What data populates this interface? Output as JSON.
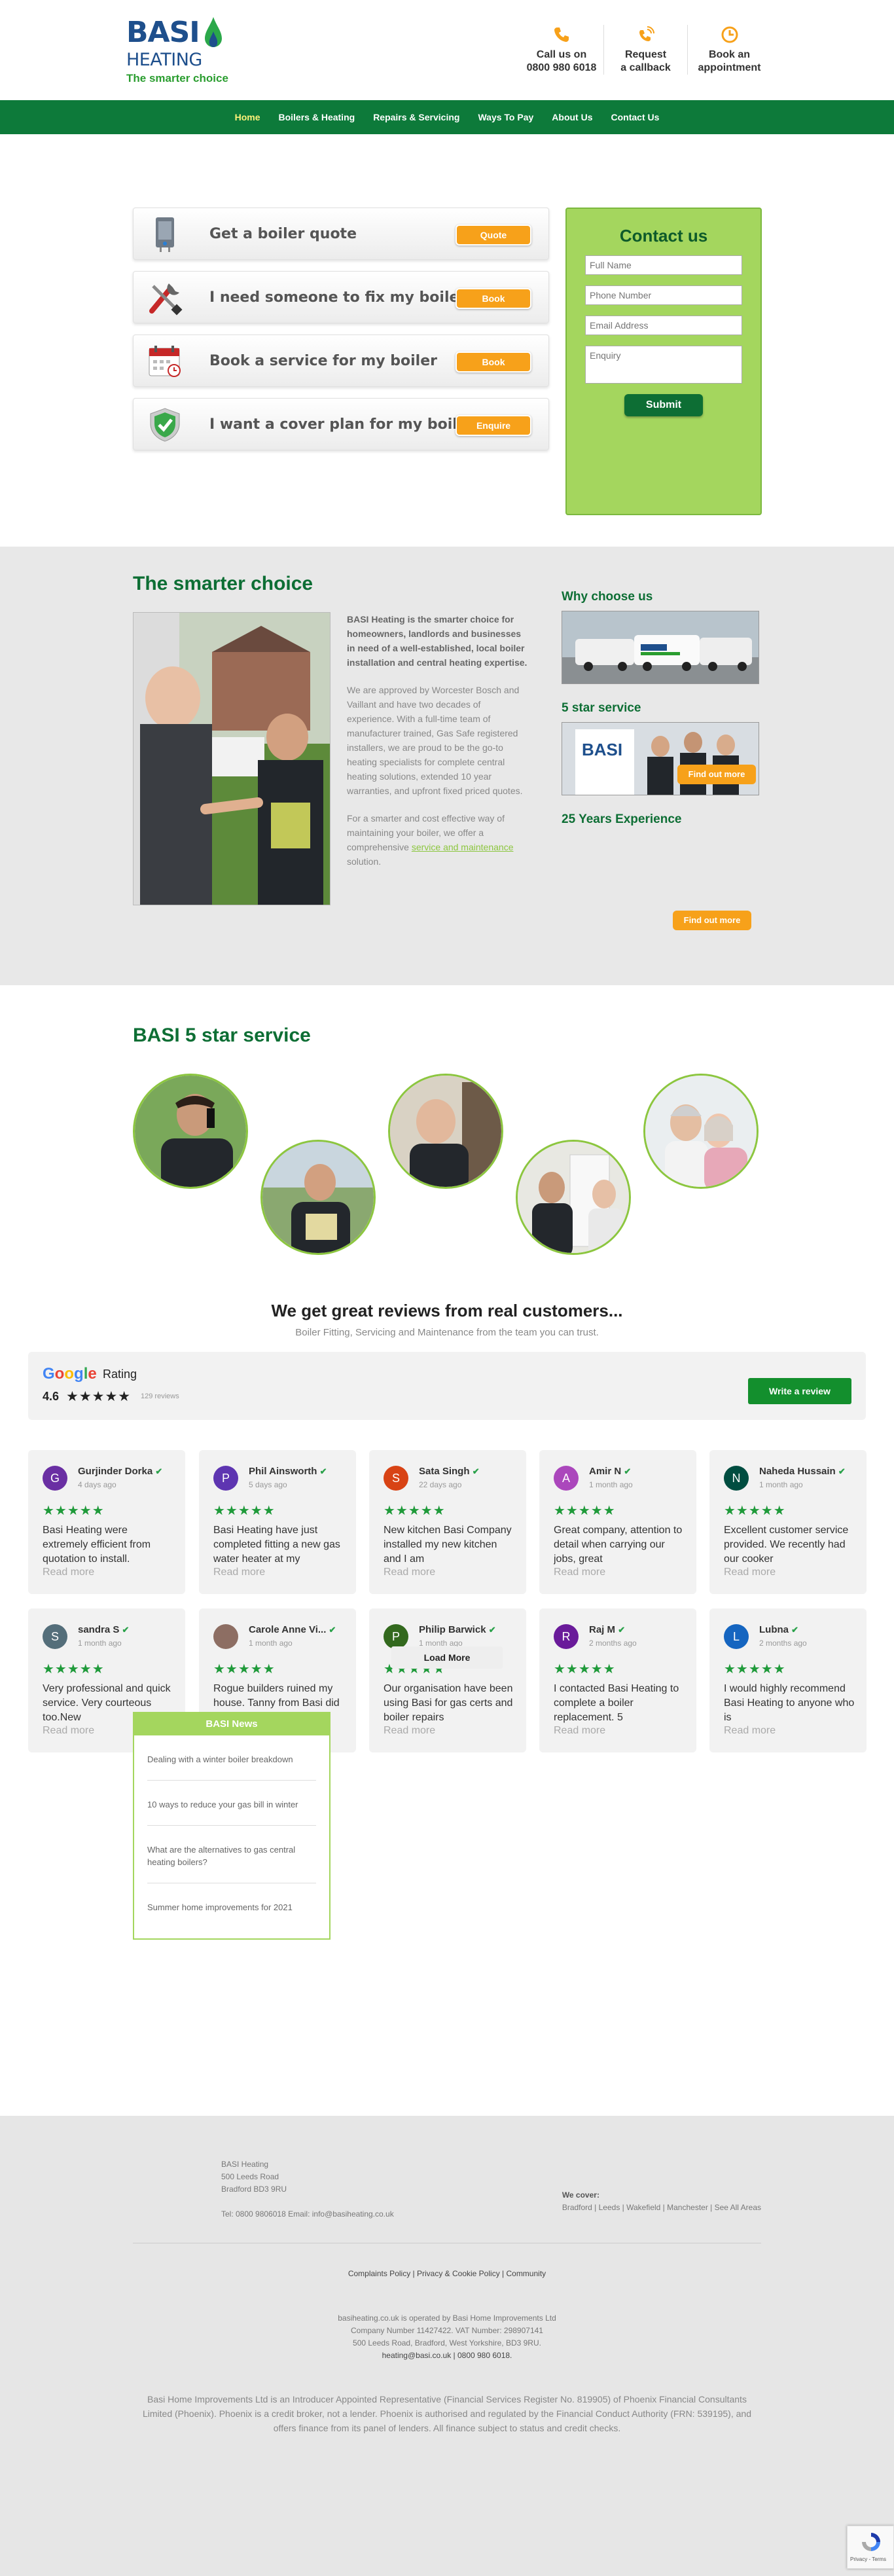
{
  "brand": {
    "name_top": "BASI",
    "name_bottom": "HEATING",
    "tagline": "The smarter choice",
    "green": "#0d7a3a",
    "orange": "#f7a11a",
    "lightgreen": "#a4d65e"
  },
  "header_contacts": [
    {
      "icon": "phone-icon",
      "line1": "Call us on",
      "line2": "0800 980 6018"
    },
    {
      "icon": "callback-icon",
      "line1": "Request",
      "line2": "a callback"
    },
    {
      "icon": "clock-icon",
      "line1": "Book an",
      "line2": "appointment"
    }
  ],
  "nav": [
    "Home",
    "Boilers & Heating",
    "Repairs & Servicing",
    "Ways To Pay",
    "About Us",
    "Contact Us"
  ],
  "cards": [
    {
      "icon": "boiler-icon",
      "text": "Get a boiler quote",
      "button": "Quote"
    },
    {
      "icon": "tools-icon",
      "text": "I need someone to fix my boiler",
      "button": "Book"
    },
    {
      "icon": "calendar-icon",
      "text": "Book a service for my boiler",
      "button": "Book"
    },
    {
      "icon": "shield-check-icon",
      "text": "I want a cover plan for my boiler",
      "button": "Enquire"
    }
  ],
  "contact_form": {
    "title": "Contact us",
    "name_placeholder": "Full Name",
    "phone_placeholder": "Phone Number",
    "email_placeholder": "Email Address",
    "enquiry_placeholder": "Enquiry",
    "submit": "Submit"
  },
  "smarter": {
    "title": "The smarter choice",
    "p1": "BASI Heating is the smarter choice for homeowners, landlords and businesses in need of a well-established, local boiler installation and central heating expertise.",
    "p2": "We are approved by Worcester Bosch and Vaillant and have two decades of experience. With a full-time team of manufacturer trained, Gas Safe registered installers, we are proud to be the go-to heating specialists for complete central heating solutions, extended 10 year warranties, and upfront fixed priced quotes.",
    "p3_a": "For a smarter and cost effective way of maintaining your boiler, we offer a comprehensive ",
    "p3_link": "service and maintenance",
    "p3_b": " solution.",
    "why_title": "Why choose us",
    "five_star_title": "5 star service",
    "years_title": "25 Years Experience",
    "find_out_more": "Find out more"
  },
  "five_star": {
    "title": "BASI 5 star service"
  },
  "reviews": {
    "heading": "We get great reviews from real customers...",
    "subheading": "Boiler Fitting, Servicing and Maintenance from the team you can trust.",
    "google": "Google",
    "rating_label": "Rating",
    "score": "4.6",
    "stars": "★★★★★",
    "count": "129 reviews",
    "write_button": "Write a review",
    "read_more": "Read more",
    "load_more": "Load More",
    "items": [
      {
        "initial": "G",
        "color": "#6a2fa3",
        "name": "Gurjinder Dorka",
        "time": "4 days ago",
        "text": "Basi Heating were extremely efficient from quotation to install."
      },
      {
        "initial": "P",
        "color": "#5e35b1",
        "name": "Phil Ainsworth",
        "time": "5 days ago",
        "text": "Basi Heating have just completed fitting a new gas water heater at my"
      },
      {
        "initial": "S",
        "color": "#d84315",
        "name": "Sata Singh",
        "time": "22 days ago",
        "text": "New kitchen Basi Company installed my new kitchen and I am"
      },
      {
        "initial": "A",
        "color": "#ab47bc",
        "name": "Amir N",
        "time": "1 month ago",
        "text": "Great company, attention to detail when carrying our jobs, great"
      },
      {
        "initial": "N",
        "color": "#004d40",
        "name": "Naheda Hussain",
        "time": "1 month ago",
        "text": "Excellent customer service provided. We recently had our cooker"
      },
      {
        "initial": "S",
        "color": "#546e7a",
        "name": "sandra S",
        "time": "1 month ago",
        "text": "Very professional and quick service. Very courteous too.New"
      },
      {
        "initial": "",
        "color": "#8d6e63",
        "name": "Carole Anne Vi...",
        "time": "1 month ago",
        "text": "Rogue builders ruined my house. Tanny from Basi did a fantastic job"
      },
      {
        "initial": "P",
        "color": "#33691e",
        "name": "Philip Barwick",
        "time": "1 month ago",
        "text": "Our organisation have been using Basi for gas certs and boiler repairs"
      },
      {
        "initial": "R",
        "color": "#6a1b9a",
        "name": "Raj M",
        "time": "2 months ago",
        "text": "I contacted Basi Heating to complete a boiler replacement. 5"
      },
      {
        "initial": "L",
        "color": "#1565c0",
        "name": "Lubna",
        "time": "2 months ago",
        "text": "I would highly recommend Basi Heating to anyone who is"
      }
    ]
  },
  "news": {
    "title": "BASI News",
    "items": [
      "Dealing with a winter boiler breakdown",
      "10 ways to reduce your gas bill in winter",
      "What are the alternatives to gas central heating boilers?",
      "Summer home improvements for 2021"
    ]
  },
  "footer": {
    "addr1": "BASI Heating",
    "addr2": "500 Leeds Road",
    "addr3": "Bradford BD3 9RU",
    "contact_line": "Tel: 0800 9806018 Email: info@basiheating.co.uk",
    "cover_label": "We cover:",
    "cover_areas": "Bradford | Leeds | Wakefield | Manchester | See All Areas",
    "links": "Complaints Policy | Privacy & Cookie Policy | Community",
    "legal1": "basiheating.co.uk is operated by Basi Home Improvements Ltd",
    "legal2": "Company Number 11427422. VAT Number: 298907141",
    "legal3": "500 Leeds Road, Bradford, West Yorkshire, BD3 9RU.",
    "legal4": "heating@basi.co.uk | 0800 980 6018.",
    "disclaimer": "Basi Home Improvements Ltd is an Introducer Appointed Representative (Financial Services Register No. 819905) of Phoenix Financial Consultants Limited (Phoenix). Phoenix is a credit broker, not a lender. Phoenix is authorised and regulated by the Financial Conduct Authority (FRN: 539195), and offers finance from its panel of lenders. All finance subject to status and credit checks."
  },
  "recaptcha": {
    "text": "Privacy - Terms"
  }
}
